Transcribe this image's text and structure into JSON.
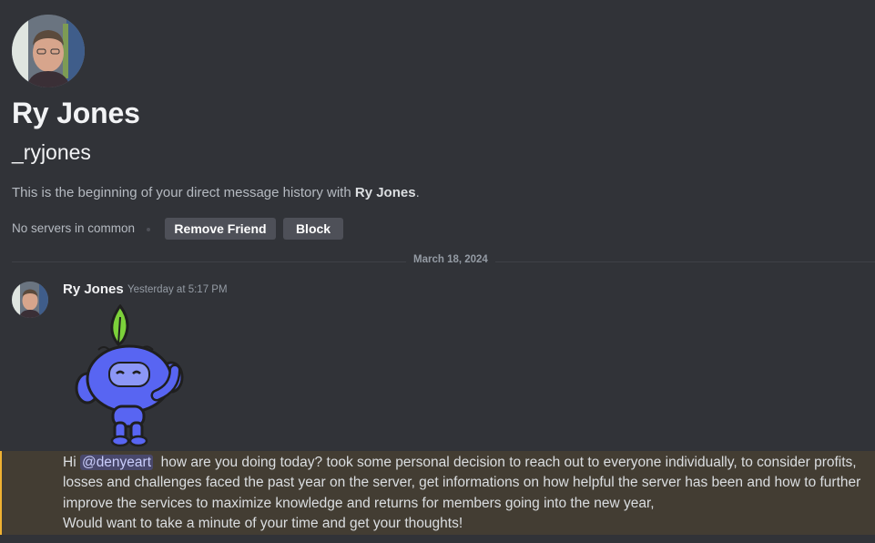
{
  "profile": {
    "display_name": "Ry Jones",
    "username": "_ryjones",
    "intro_prefix": "This is the beginning of your direct message history with ",
    "intro_name": "Ry Jones",
    "intro_suffix": ".",
    "mutual_servers": "No servers in common",
    "remove_friend_label": "Remove Friend",
    "block_label": "Block"
  },
  "divider": {
    "date": "March 18, 2024"
  },
  "message": {
    "author": "Ry Jones",
    "timestamp": "Yesterday at 5:17 PM",
    "sticker": "wumpus-leaf-sticker",
    "text_prefix": "Hi ",
    "mention": "@denyeart",
    "text_line1": "  how are you doing today? took some personal decision to reach out to everyone individually, to consider profits, losses and challenges faced the past year on the server, get informations on how helpful the server has been and how to further improve the services to maximize knowledge and returns for members going into the new year,",
    "text_line2": "Would want to take a minute of your time and get your thoughts!"
  },
  "colors": {
    "background": "#313338",
    "mention_highlight": "#433d33",
    "button": "#4e5058",
    "wumpus": "#5865f2",
    "leaf": "#7cd13a"
  }
}
